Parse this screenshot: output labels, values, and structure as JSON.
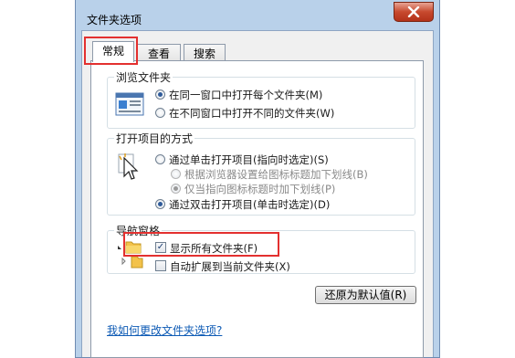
{
  "window": {
    "title": "文件夹选项"
  },
  "tabs": [
    {
      "label": "常规",
      "active": true
    },
    {
      "label": "查看",
      "active": false
    },
    {
      "label": "搜索",
      "active": false
    }
  ],
  "browse_group": {
    "label": "浏览文件夹",
    "options": [
      {
        "label": "在同一窗口中打开每个文件夹(M)",
        "selected": true
      },
      {
        "label": "在不同窗口中打开不同的文件夹(W)",
        "selected": false
      }
    ]
  },
  "click_group": {
    "label": "打开项目的方式",
    "options": [
      {
        "label": "通过单击打开项目(指向时选定)(S)",
        "selected": false,
        "enabled": true
      },
      {
        "label": "根据浏览器设置给图标标题加下划线(B)",
        "selected": false,
        "enabled": false
      },
      {
        "label": "仅当指向图标标题时加下划线(P)",
        "selected": true,
        "enabled": false
      },
      {
        "label": "通过双击打开项目(单击时选定)(D)",
        "selected": true,
        "enabled": true
      }
    ]
  },
  "nav_group": {
    "label": "导航窗格",
    "options": [
      {
        "label": "显示所有文件夹(F)",
        "checked": true
      },
      {
        "label": "自动扩展到当前文件夹(X)",
        "checked": false
      }
    ]
  },
  "restore_button": "还原为默认值(R)",
  "help_link": "我如何更改文件夹选项?",
  "colors": {
    "highlight": "#e3302f",
    "link": "#0e5bb5",
    "title_bar": "#b9d1ea"
  }
}
